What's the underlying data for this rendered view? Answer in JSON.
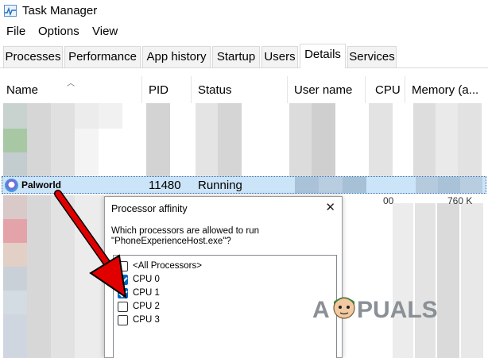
{
  "window": {
    "title": "Task Manager",
    "icon": "task-manager-icon"
  },
  "menu": {
    "items": [
      "File",
      "Options",
      "View"
    ]
  },
  "tabs": [
    {
      "label": "Processes",
      "active": false
    },
    {
      "label": "Performance",
      "active": false
    },
    {
      "label": "App history",
      "active": false
    },
    {
      "label": "Startup",
      "active": false
    },
    {
      "label": "Users",
      "active": false
    },
    {
      "label": "Details",
      "active": true
    },
    {
      "label": "Services",
      "active": false
    }
  ],
  "columns": [
    "Name",
    "PID",
    "Status",
    "User name",
    "CPU",
    "Memory (a..."
  ],
  "selected_row": {
    "name": "Palworld",
    "pid": "11480",
    "status": "Running",
    "icon": "palworld-icon"
  },
  "partial_values": {
    "cpu": "00",
    "memory": "760 K"
  },
  "dialog": {
    "title": "Processor affinity",
    "question_line1": "Which processors are allowed to run",
    "question_line2": "\"PhoneExperienceHost.exe\"?",
    "processors": [
      {
        "label": "<All Processors>",
        "checked": false
      },
      {
        "label": "CPU 0",
        "checked": true
      },
      {
        "label": "CPU 1",
        "checked": true
      },
      {
        "label": "CPU 2",
        "checked": false
      },
      {
        "label": "CPU 3",
        "checked": false
      }
    ]
  },
  "watermark": {
    "text_a": "A",
    "text_b": "PUALS"
  },
  "colors": {
    "selection": "#cce4f7",
    "checkbox_accent": "#0067c0",
    "arrow": "#e00000"
  }
}
